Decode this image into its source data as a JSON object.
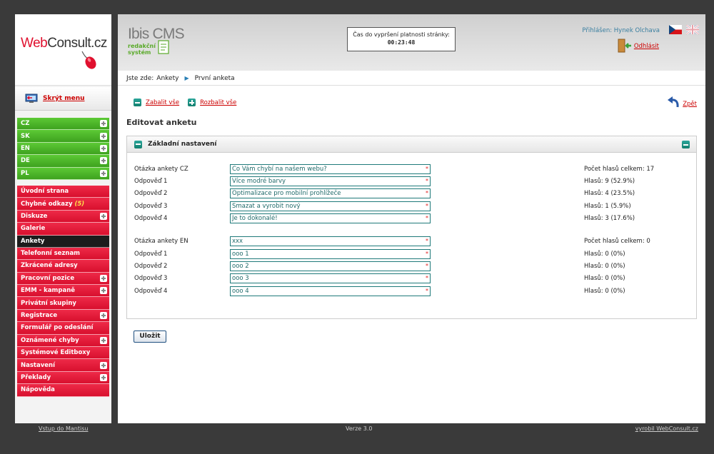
{
  "brand": {
    "logo_part1": "Web",
    "logo_part2": "Consult.cz",
    "cms_title": "Ibis CMS",
    "cms_sub": "redakční systém"
  },
  "sidebar": {
    "hide_menu": "Skrýt menu",
    "lang_items": [
      {
        "label": "CZ"
      },
      {
        "label": "SK"
      },
      {
        "label": "EN"
      },
      {
        "label": "DE"
      },
      {
        "label": "PL"
      }
    ],
    "menu_items": [
      {
        "label": "Úvodní strana",
        "has_plus": false
      },
      {
        "label": "Chybné odkazy",
        "count": "(5)",
        "has_plus": false
      },
      {
        "label": "Diskuze",
        "has_plus": true
      },
      {
        "label": "Galerie",
        "has_plus": false
      },
      {
        "label": "Ankety",
        "has_plus": false,
        "active": true
      },
      {
        "label": "Telefonní seznam",
        "has_plus": false
      },
      {
        "label": "Zkrácené adresy",
        "has_plus": false
      },
      {
        "label": "Pracovní pozice",
        "has_plus": true
      },
      {
        "label": "EMM - kampaně",
        "has_plus": true
      },
      {
        "label": "Privátní skupiny",
        "has_plus": false
      },
      {
        "label": "Registrace",
        "has_plus": true
      },
      {
        "label": "Formulář po odeslání",
        "has_plus": false
      },
      {
        "label": "Oznámené chyby",
        "has_plus": true
      },
      {
        "label": "Systémové Editboxy",
        "has_plus": false
      },
      {
        "label": "Nastavení",
        "has_plus": true
      },
      {
        "label": "Překlady",
        "has_plus": true
      },
      {
        "label": "Nápověda",
        "has_plus": false
      }
    ]
  },
  "header": {
    "timer_label": "Čas do vypršení platnosti stránky:",
    "timer_value": "00:23:48",
    "logged_in": "Přihlášen: Hynek Olchava",
    "logout": "Odhlásit"
  },
  "breadcrumb": {
    "prefix": "Jste zde:",
    "item1": "Ankety",
    "item2": "První anketa"
  },
  "toolbar": {
    "collapse_all": "Zabalit vše",
    "expand_all": "Rozbalit vše",
    "back": "Zpět"
  },
  "page_title": "Editovat anketu",
  "panel": {
    "title": "Základní nastavení"
  },
  "form": {
    "rows": [
      {
        "label": "Otázka ankety CZ",
        "value": "Co Vám chybí na našem webu?",
        "stat": "Počet hlasů celkem: 17"
      },
      {
        "label": "Odpověď 1",
        "value": "Více modré barvy",
        "stat": "Hlasů: 9 (52.9%)"
      },
      {
        "label": "Odpověď 2",
        "value": "Optimalizace pro mobilní prohlížeče",
        "stat": "Hlasů: 4 (23.5%)"
      },
      {
        "label": "Odpověď 3",
        "value": "Smazat a vyrobit nový",
        "stat": "Hlasů: 1 (5.9%)"
      },
      {
        "label": "Odpověď 4",
        "value": "Je to dokonalé!",
        "stat": "Hlasů: 3 (17.6%)"
      },
      {
        "label": "Otázka ankety EN",
        "value": "xxx",
        "stat": "Počet hlasů celkem: 0"
      },
      {
        "label": "Odpověď 1",
        "value": "ooo 1",
        "stat": "Hlasů: 0 (0%)"
      },
      {
        "label": "Odpověď 2",
        "value": "ooo 2",
        "stat": "Hlasů: 0 (0%)"
      },
      {
        "label": "Odpověď 3",
        "value": "ooo 3",
        "stat": "Hlasů: 0 (0%)"
      },
      {
        "label": "Odpověď 4",
        "value": "ooo 4",
        "stat": "Hlasů: 0 (0%)"
      }
    ],
    "required_mark": "*",
    "save": "Uložit"
  },
  "footer": {
    "left": "Vstup do Mantisu",
    "mid": "Verze 3.0",
    "right": "vyrobil WebConsult.cz"
  }
}
